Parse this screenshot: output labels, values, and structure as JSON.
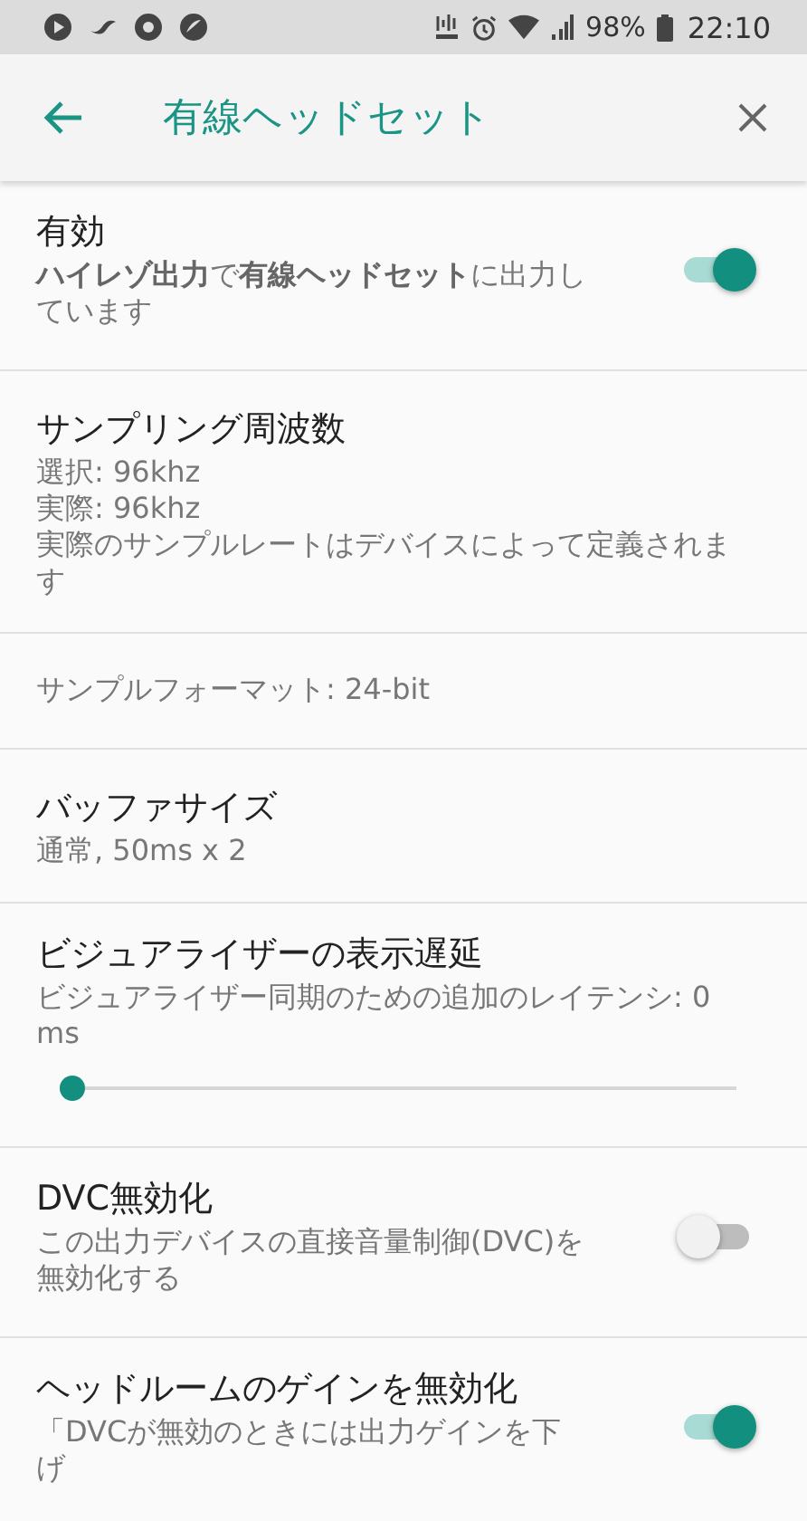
{
  "status_bar": {
    "battery": "98%",
    "time": "22:10"
  },
  "toolbar": {
    "title": "有線ヘッドセット"
  },
  "items": [
    {
      "kind": "switch",
      "title": "有効",
      "summary": "**ハイレゾ出力**で**有線ヘッドセット**に出力しています",
      "on": true
    },
    {
      "kind": "text",
      "title": "サンプリング周波数",
      "lines": [
        "選択: 96khz",
        "実際: 96khz",
        "実際のサンプルレートはデバイスによって定義されます"
      ]
    },
    {
      "kind": "info",
      "text": "サンプルフォーマット: 24-bit"
    },
    {
      "kind": "text",
      "title": "バッファサイズ",
      "lines": [
        "通常, 50ms x 2"
      ]
    },
    {
      "kind": "slider",
      "title": "ビジュアライザーの表示遅延",
      "lines": [
        "ビジュアライザー同期のための追加のレイテンシ: 0 ms"
      ],
      "level": 0
    },
    {
      "kind": "switch",
      "title": "DVC無効化",
      "summary": "この出力デバイスの直接音量制御(DVC)を無効化する",
      "on": false
    },
    {
      "kind": "switch",
      "title": "ヘッドルームのゲインを無効化",
      "summary": "「DVCが無効のときには出力ゲインを下げ",
      "on": true
    }
  ]
}
